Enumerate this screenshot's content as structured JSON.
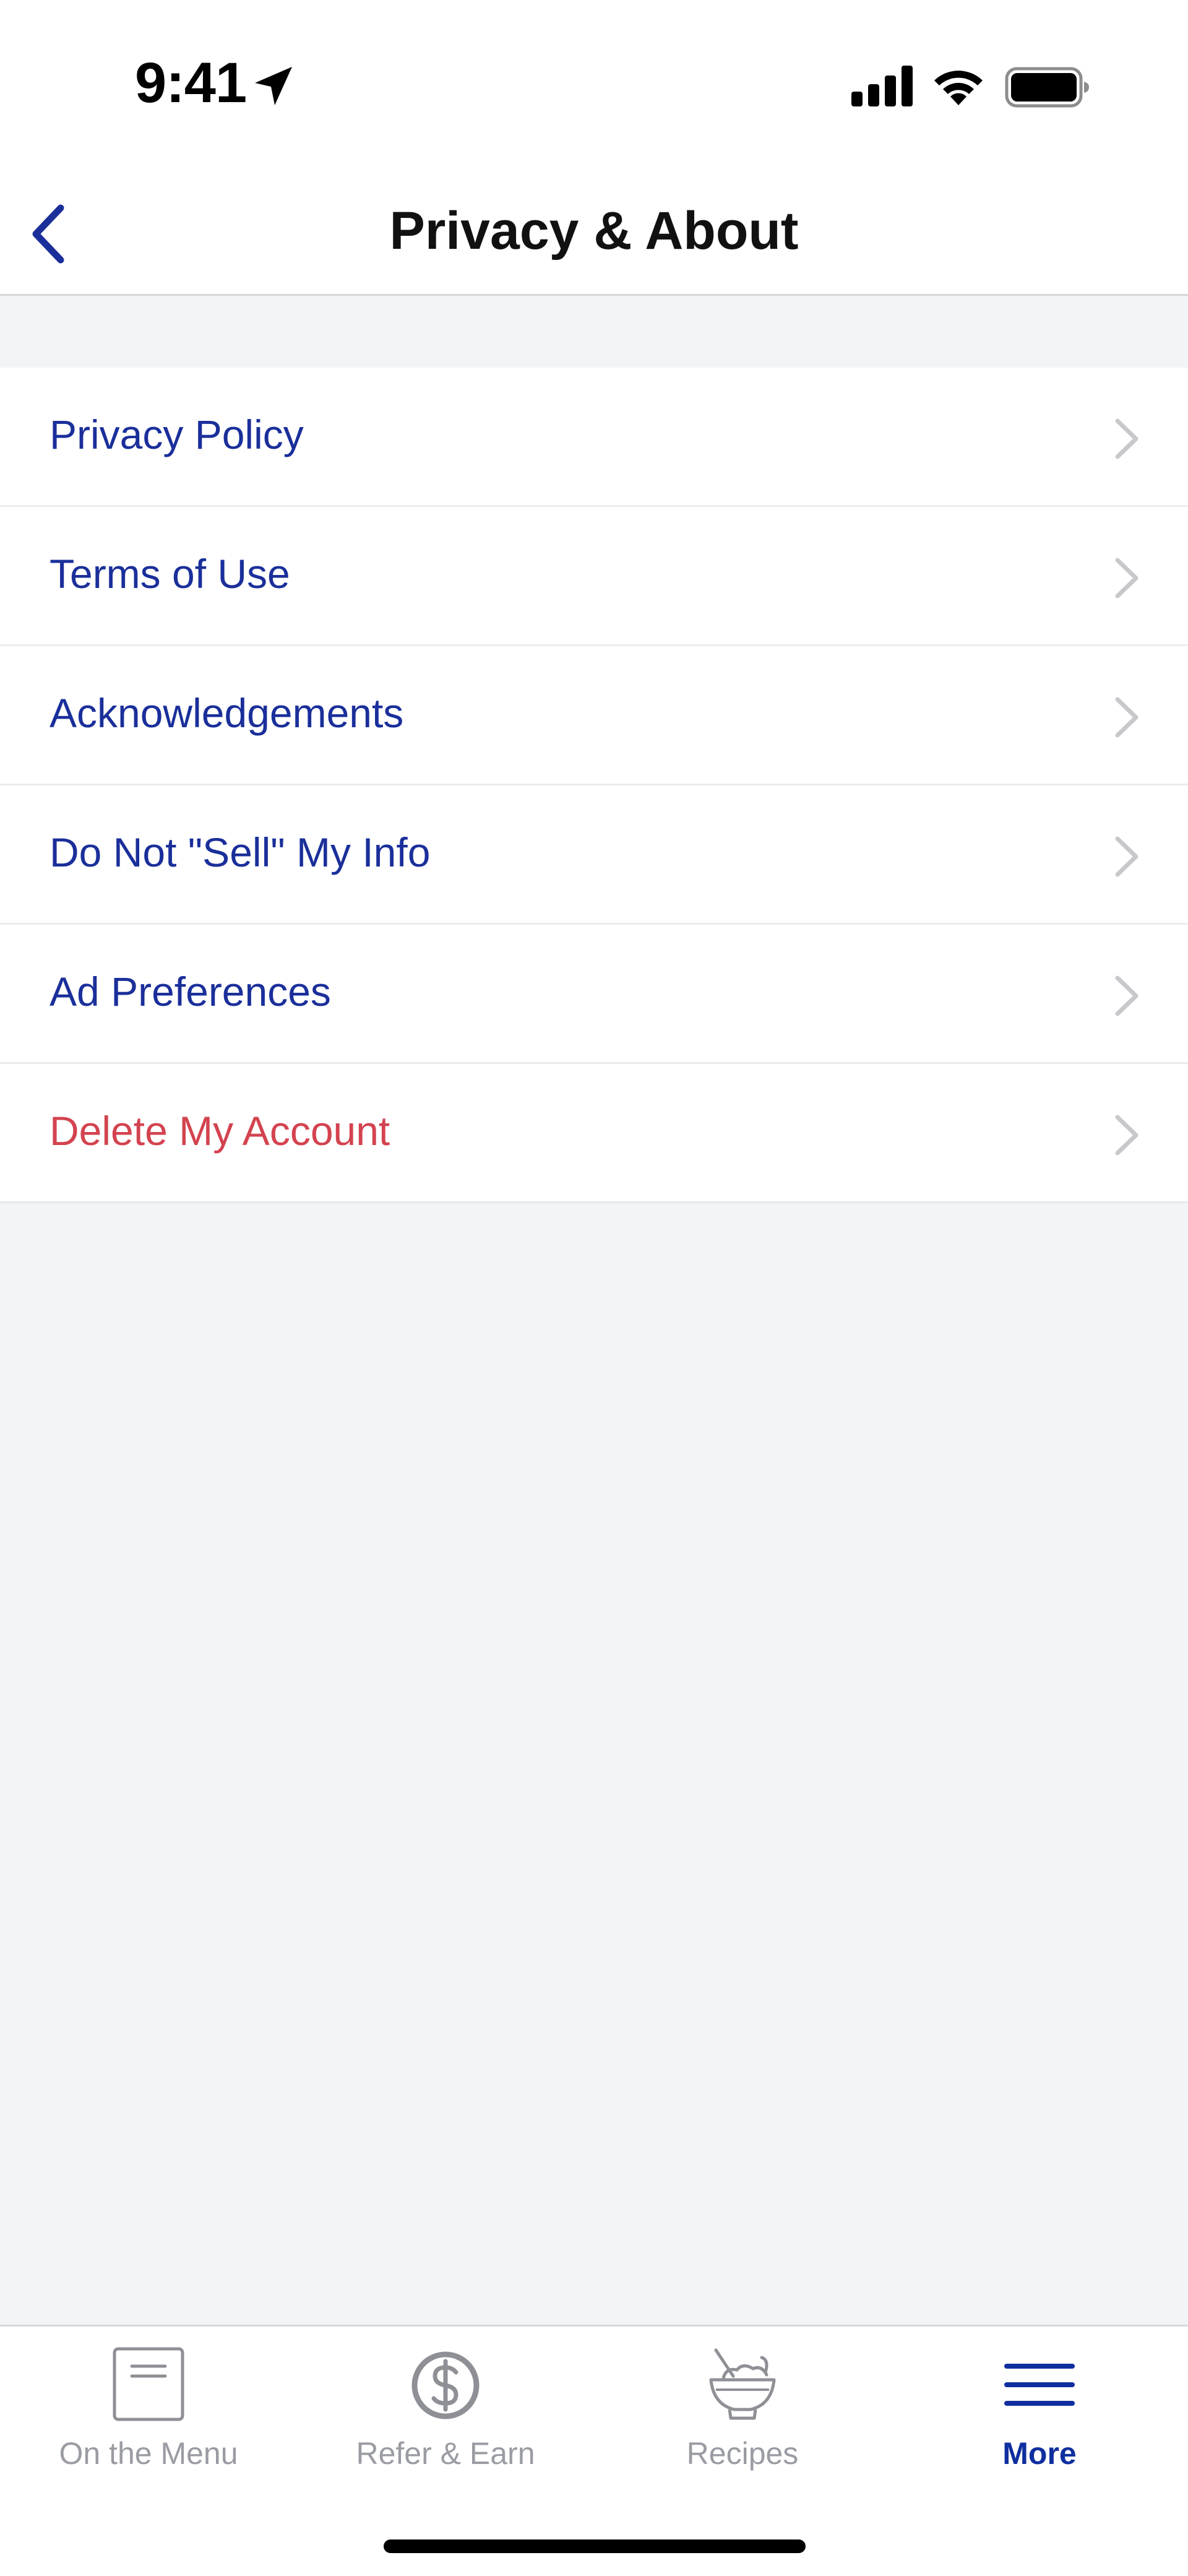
{
  "status_bar": {
    "time": "9:41",
    "icons": [
      "location-arrow-icon",
      "cellular-signal-icon",
      "wifi-icon",
      "battery-icon"
    ]
  },
  "header": {
    "title": "Privacy & About",
    "back_icon": "chevron-left-icon"
  },
  "menu": {
    "items": [
      {
        "label": "Privacy Policy"
      },
      {
        "label": "Terms of Use"
      },
      {
        "label": "Acknowledgements"
      },
      {
        "label": "Do Not \"Sell\" My Info"
      },
      {
        "label": "Ad Preferences"
      },
      {
        "label": "Delete My Account"
      }
    ]
  },
  "tab_bar": {
    "tabs": [
      {
        "label": "On the Menu",
        "icon": "menu-card-icon"
      },
      {
        "label": "Refer & Earn",
        "icon": "dollar-circle-icon"
      },
      {
        "label": "Recipes",
        "icon": "mixing-bowl-icon"
      },
      {
        "label": "More",
        "icon": "hamburger-menu-icon"
      }
    ],
    "active": "More"
  },
  "colors": {
    "link": "#1a2f9a",
    "danger": "#d3434f",
    "active_tab": "#0f2f9f",
    "inactive_tab": "#9a9ca3",
    "background": "#f3f4f6"
  }
}
